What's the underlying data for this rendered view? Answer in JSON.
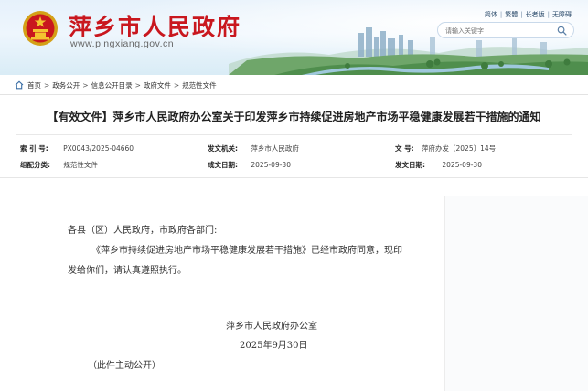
{
  "header": {
    "site_name": "萍乡市人民政府",
    "site_url": "www.pingxiang.gov.cn",
    "top_links": [
      "简体",
      "繁體",
      "长者版",
      "无障碍"
    ],
    "search_placeholder": "请输入关键字"
  },
  "breadcrumb": [
    "首页",
    "政务公开",
    "信息公开目录",
    "政府文件",
    "规范性文件"
  ],
  "document": {
    "title": "【有效文件】萍乡市人民政府办公室关于印发萍乡市持续促进房地产市场平稳健康发展若干措施的通知",
    "meta": {
      "index_label": "索 引 号:",
      "index_value": "PX0043/2025-04660",
      "issuer_label": "发文机关:",
      "issuer_value": "萍乡市人民政府",
      "doc_no_label": "文    号:",
      "doc_no_value": "萍府办发〔2025〕14号",
      "category_label": "组配分类:",
      "category_value": "规范性文件",
      "created_label": "成文日期:",
      "created_value": "2025-09-30",
      "published_label": "发文日期:",
      "published_value": "2025-09-30"
    },
    "salutation": "各县（区）人民政府，市政府各部门:",
    "para1_line1": "《萍乡市持续促进房地产市场平稳健康发展若干措施》已经市政府同意，现印",
    "para1_line2": "发给你们，请认真遵照执行。",
    "signature": "萍乡市人民政府办公室",
    "date": "2025年9月30日",
    "note": "（此件主动公开）"
  },
  "colors": {
    "brand_red": "#c9171e",
    "url_gray": "#666666"
  }
}
